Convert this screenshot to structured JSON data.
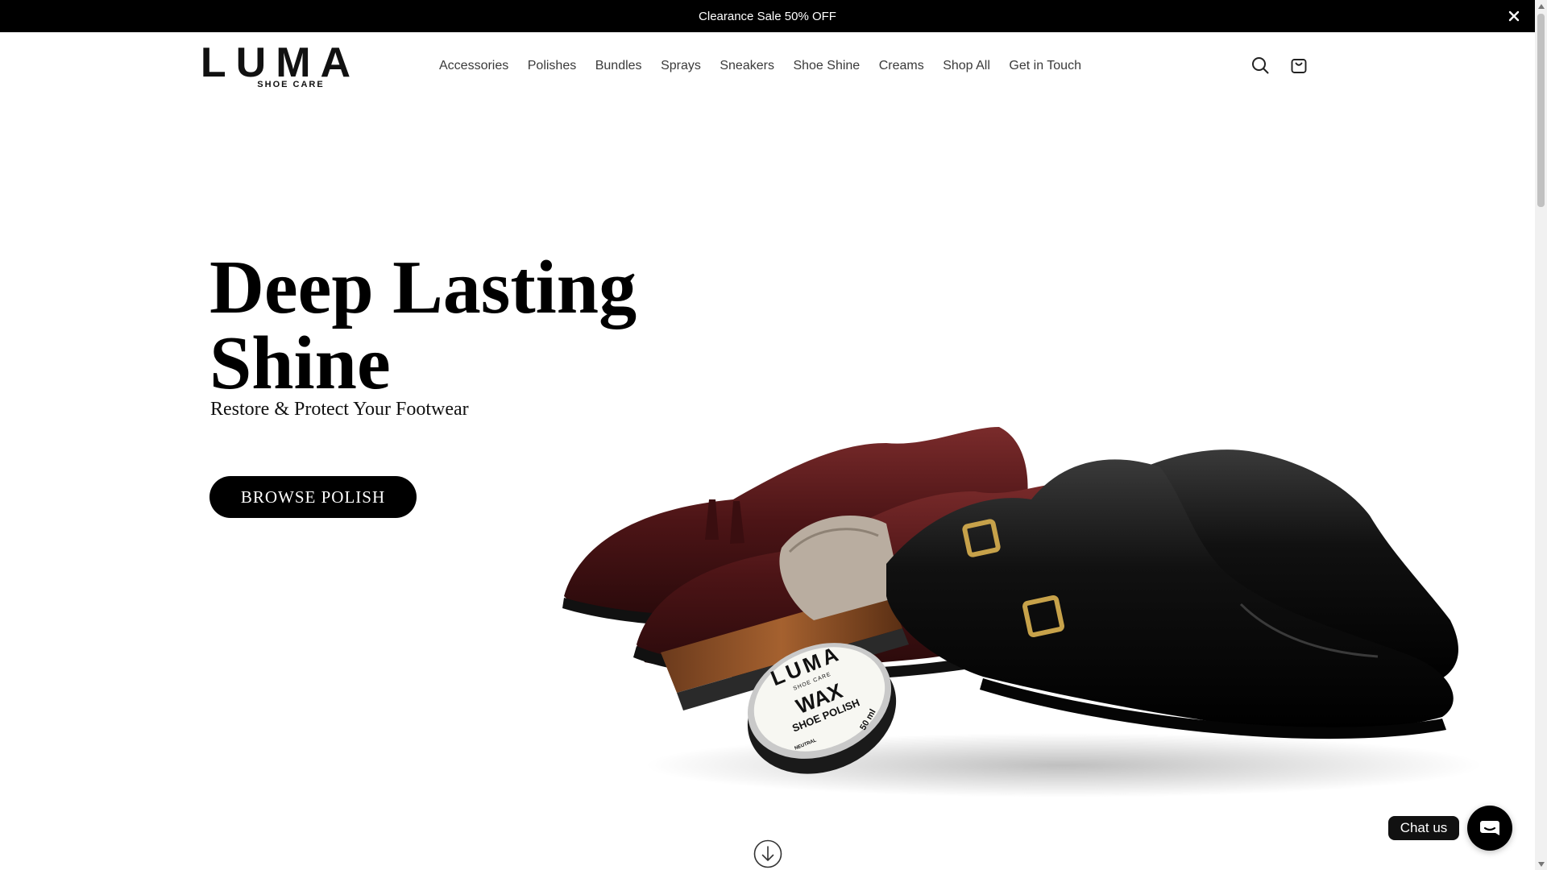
{
  "announcement": {
    "text": "Clearance Sale 50% OFF"
  },
  "brand": {
    "name": "LUMA",
    "tagline": "SHOE CARE"
  },
  "nav": {
    "items": [
      {
        "label": "Accessories"
      },
      {
        "label": "Polishes"
      },
      {
        "label": "Bundles"
      },
      {
        "label": "Sprays"
      },
      {
        "label": "Sneakers"
      },
      {
        "label": "Shoe Shine"
      },
      {
        "label": "Creams"
      },
      {
        "label": "Shop All"
      },
      {
        "label": "Get in Touch"
      }
    ]
  },
  "hero": {
    "title": "Deep Lasting Shine",
    "subtitle": "Restore & Protect Your Footwear",
    "cta_label": "BROWSE POLISH",
    "tin": {
      "brand": "LUMA",
      "brand_sub": "SHOE CARE",
      "line1": "WAX",
      "line2": "SHOE POLISH",
      "volume": "50 ml",
      "shade": "NEUTRAL"
    }
  },
  "chat": {
    "label": "Chat us"
  },
  "icons": {
    "close": "close-icon",
    "search": "search-icon",
    "cart": "cart-icon",
    "scroll": "arrow-down-circle-icon",
    "chat": "chat-bubble-icon"
  },
  "colors": {
    "announcement_bg": "#000000",
    "accent": "#000000",
    "nav_text": "#3a3a3a"
  }
}
